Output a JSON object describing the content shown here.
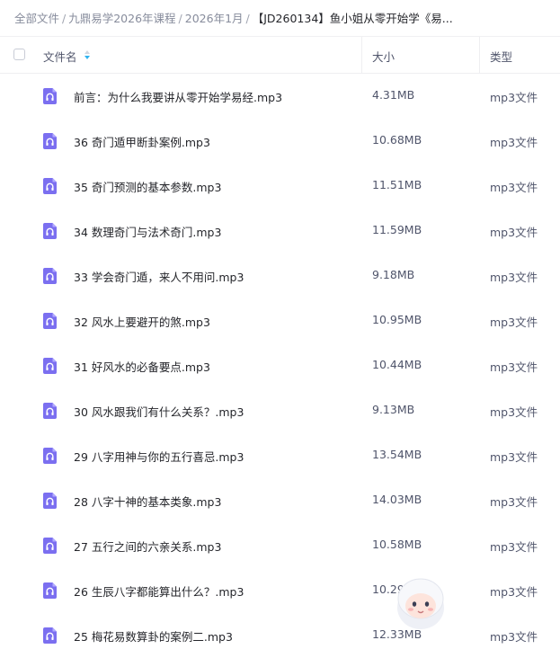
{
  "breadcrumb": {
    "items": [
      "全部文件",
      "九鼎易学2026年课程",
      "2026年1月"
    ],
    "separator": "/",
    "current": "【JD260134】鱼小姐从零开始学《易..."
  },
  "table": {
    "columns": {
      "name": "文件名",
      "size": "大小",
      "type": "类型"
    },
    "rows": [
      {
        "name": "前言：为什么我要讲从零开始学易经.mp3",
        "size": "4.31MB",
        "type": "mp3文件"
      },
      {
        "name": "36 奇门遁甲断卦案例.mp3",
        "size": "10.68MB",
        "type": "mp3文件"
      },
      {
        "name": "35 奇门预测的基本参数.mp3",
        "size": "11.51MB",
        "type": "mp3文件"
      },
      {
        "name": "34 数理奇门与法术奇门.mp3",
        "size": "11.59MB",
        "type": "mp3文件"
      },
      {
        "name": "33 学会奇门遁，来人不用问.mp3",
        "size": "9.18MB",
        "type": "mp3文件"
      },
      {
        "name": "32 风水上要避开的煞.mp3",
        "size": "10.95MB",
        "type": "mp3文件"
      },
      {
        "name": "31 好风水的必备要点.mp3",
        "size": "10.44MB",
        "type": "mp3文件"
      },
      {
        "name": "30 风水跟我们有什么关系？.mp3",
        "size": "9.13MB",
        "type": "mp3文件"
      },
      {
        "name": "29 八字用神与你的五行喜忌.mp3",
        "size": "13.54MB",
        "type": "mp3文件"
      },
      {
        "name": "28 八字十神的基本类象.mp3",
        "size": "14.03MB",
        "type": "mp3文件"
      },
      {
        "name": "27 五行之间的六亲关系.mp3",
        "size": "10.58MB",
        "type": "mp3文件"
      },
      {
        "name": "26 生辰八字都能算出什么？.mp3",
        "size": "10.29MB",
        "type": "mp3文件"
      },
      {
        "name": "25 梅花易数算卦的案例二.mp3",
        "size": "12.33MB",
        "type": "mp3文件"
      }
    ]
  },
  "icons": {
    "file": "headphones-audio-file-icon",
    "sort": "sort-icon",
    "mascot": "mascot-icon"
  },
  "colors": {
    "file_icon": "#7b6ff0",
    "sort_active": "#2fb3f0",
    "text": "#25262b",
    "muted": "#878c9c"
  }
}
